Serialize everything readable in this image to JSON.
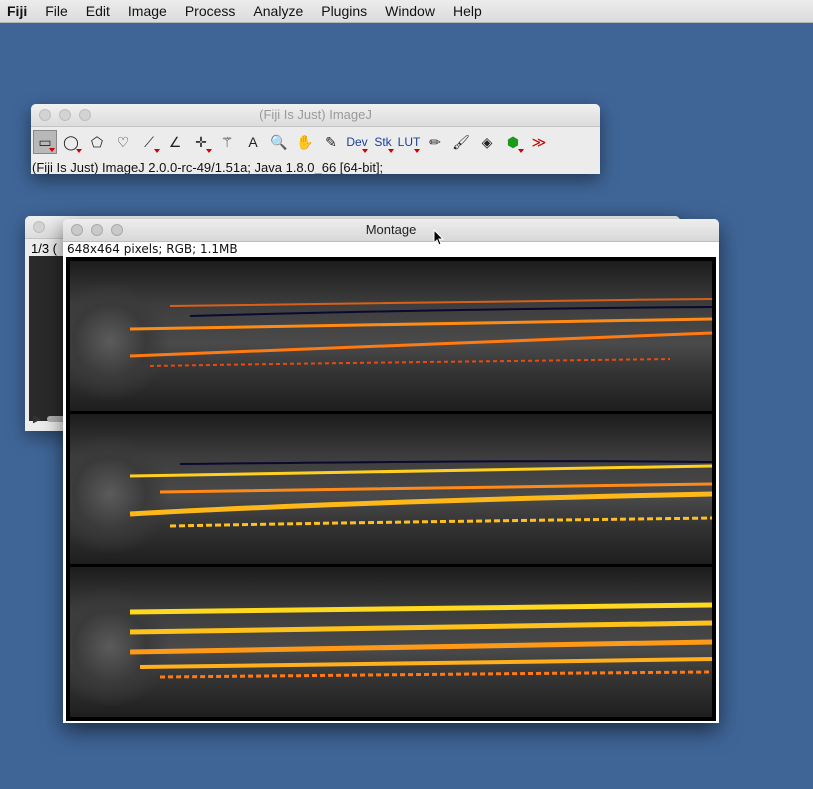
{
  "menubar": {
    "app": "Fiji",
    "items": [
      "File",
      "Edit",
      "Image",
      "Process",
      "Analyze",
      "Plugins",
      "Window",
      "Help"
    ]
  },
  "toolbar_window": {
    "title": "(Fiji Is Just) ImageJ",
    "status": "(Fiji Is Just) ImageJ 2.0.0-rc-49/1.51a; Java 1.8.0_66 [64-bit];",
    "tools": [
      {
        "name": "rectangle-tool-icon",
        "glyph": "▭"
      },
      {
        "name": "oval-tool-icon",
        "glyph": "◯"
      },
      {
        "name": "polygon-tool-icon",
        "glyph": "⬠"
      },
      {
        "name": "freehand-tool-icon",
        "glyph": "♡"
      },
      {
        "name": "line-tool-icon",
        "glyph": "⟋"
      },
      {
        "name": "angle-tool-icon",
        "glyph": "∠"
      },
      {
        "name": "point-tool-icon",
        "glyph": "✛"
      },
      {
        "name": "wand-tool-icon",
        "glyph": "⚚"
      },
      {
        "name": "text-tool-icon",
        "glyph": "A"
      },
      {
        "name": "magnifier-tool-icon",
        "glyph": "🔍"
      },
      {
        "name": "hand-tool-icon",
        "glyph": "✋"
      },
      {
        "name": "dropper-tool-icon",
        "glyph": "✎"
      },
      {
        "name": "dev-tool",
        "glyph": "Dev"
      },
      {
        "name": "stk-tool",
        "glyph": "Stk"
      },
      {
        "name": "lut-tool",
        "glyph": "LUT"
      },
      {
        "name": "pencil-tool-icon",
        "glyph": "✏"
      },
      {
        "name": "brush-tool-icon",
        "glyph": "🖌"
      },
      {
        "name": "flood-fill-tool-icon",
        "glyph": "◈"
      },
      {
        "name": "color-picker-icon",
        "glyph": "⬢"
      },
      {
        "name": "more-tools-icon",
        "glyph": "≫"
      }
    ]
  },
  "stack_window": {
    "info": "1/3 ("
  },
  "montage_window": {
    "title": "Montage",
    "info": "648x464 pixels; RGB; 1.1MB"
  }
}
